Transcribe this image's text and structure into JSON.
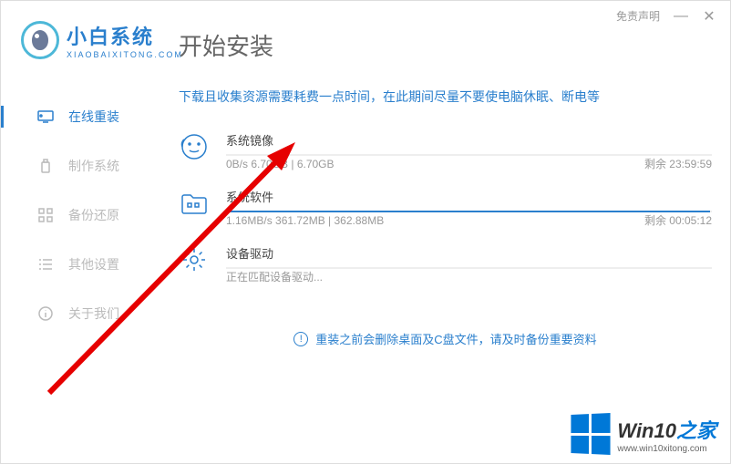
{
  "titlebar": {
    "disclaimer": "免责声明",
    "minimize": "—",
    "close": "✕"
  },
  "logo": {
    "title": "小白系统",
    "sub": "XIAOBAIXITONG.COM"
  },
  "sidebar": {
    "items": [
      {
        "label": "在线重装",
        "icon": "monitor-icon",
        "active": true
      },
      {
        "label": "制作系统",
        "icon": "usb-icon",
        "active": false
      },
      {
        "label": "备份还原",
        "icon": "grid-icon",
        "active": false
      },
      {
        "label": "其他设置",
        "icon": "list-icon",
        "active": false
      },
      {
        "label": "关于我们",
        "icon": "info-icon",
        "active": false
      }
    ]
  },
  "main": {
    "title": "开始安装",
    "hint": "下载且收集资源需要耗费一点时间，在此期间尽量不要使电脑休眠、断电等",
    "downloads": [
      {
        "title": "系统镜像",
        "stats": "0B/s 6.70GB | 6.70GB",
        "remain": "剩余 23:59:59",
        "progress": 0
      },
      {
        "title": "系统软件",
        "stats": "1.16MB/s 361.72MB | 362.88MB",
        "remain": "剩余 00:05:12",
        "progress": 99.7
      },
      {
        "title": "设备驱动",
        "stats": "正在匹配设备驱动...",
        "remain": "",
        "progress": 0
      }
    ],
    "warning": "重装之前会删除桌面及C盘文件，请及时备份重要资料"
  },
  "watermark": {
    "title_pre": "Win",
    "title_num": "10",
    "title_post": "之家",
    "url": "www.win10xitong.com"
  }
}
